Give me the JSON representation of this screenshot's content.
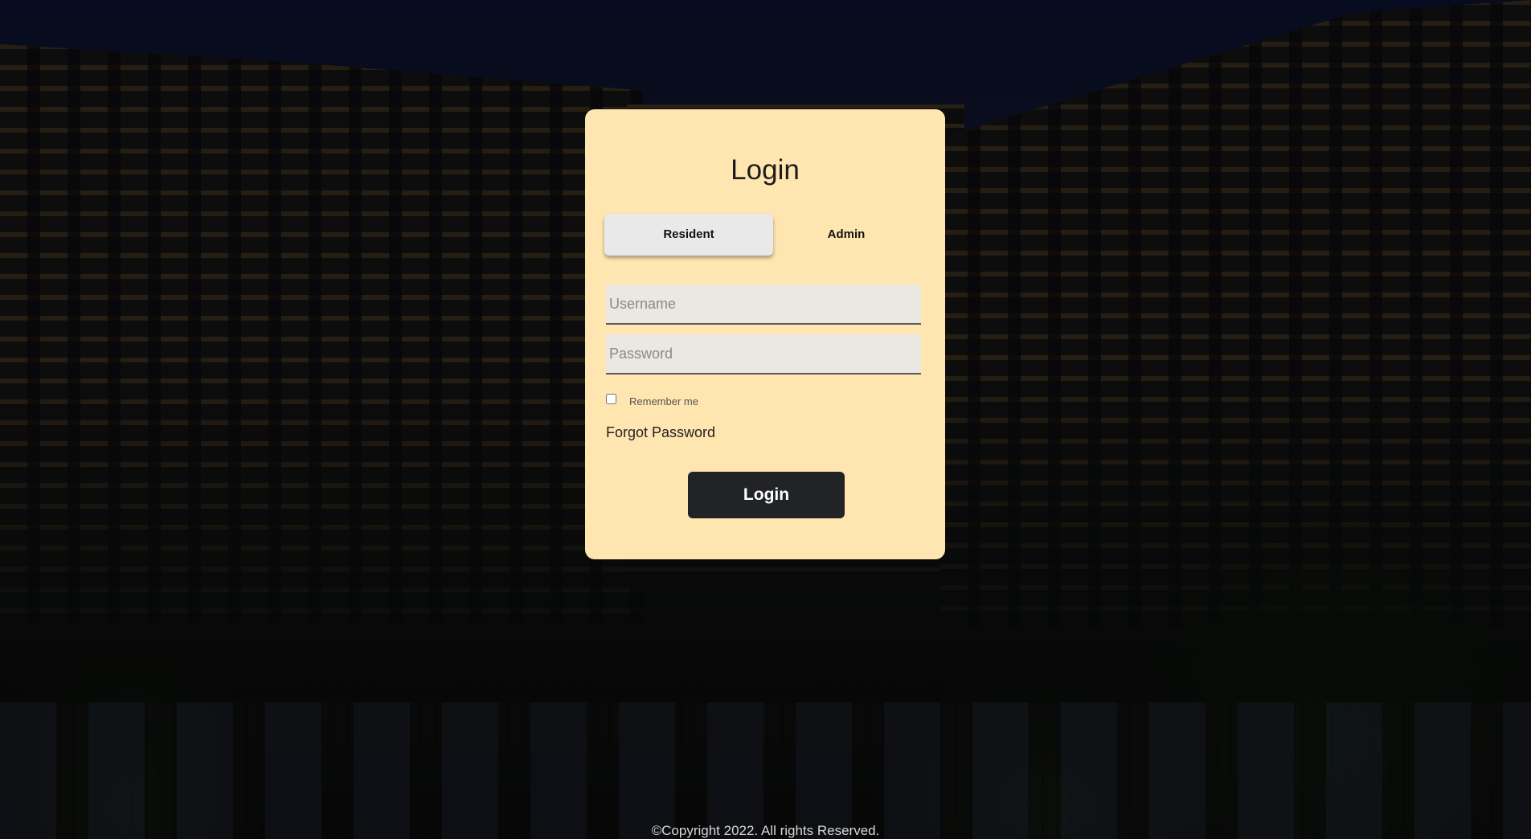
{
  "login_card": {
    "title": "Login",
    "tabs": [
      {
        "label": "Resident",
        "active": true
      },
      {
        "label": "Admin",
        "active": false
      }
    ],
    "username": {
      "placeholder": "Username",
      "value": ""
    },
    "password": {
      "placeholder": "Password",
      "value": ""
    },
    "remember_me": {
      "label": "Remember me",
      "checked": false
    },
    "forgot_password": "Forgot Password",
    "submit_label": "Login"
  },
  "footer": {
    "copyright": "©Copyright 2022. All rights Reserved."
  },
  "colors": {
    "card_background": "#ffe5b0",
    "button_background": "#222325",
    "active_tab_background": "#e9e9e9"
  }
}
